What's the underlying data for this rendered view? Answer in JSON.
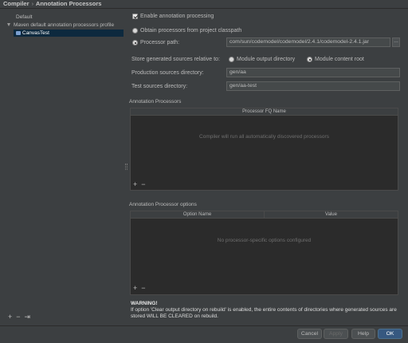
{
  "breadcrumb": {
    "part1": "Compiler",
    "separator": "›",
    "part2": "Annotation Processors"
  },
  "tree": {
    "default_label": "Default",
    "profile_label": "Maven default annotation processors profile",
    "module_label": "CanvasTest"
  },
  "left_toolbar": {
    "add": "+",
    "remove": "−",
    "move": "⇥"
  },
  "enable_processing_label": "Enable annotation processing",
  "obtain_processors_label": "Obtain processors from project classpath",
  "processor_path_label": "Processor path:",
  "processor_path_value": "com/sun/codemodel/codemodel/2.4.1/codemodel-2.4.1.jar",
  "browse_label": "…",
  "store_generated_label": "Store generated sources relative to:",
  "module_output_label": "Module output directory",
  "module_content_label": "Module content root",
  "production_dir_label": "Production sources directory:",
  "production_dir_value": "gen/aa",
  "test_dir_label": "Test sources directory:",
  "test_dir_value": "gen/aa-test",
  "processors_section_label": "Annotation Processors",
  "processors_column_header": "Processor FQ Name",
  "processors_empty_text": "Compiler will run all automatically discovered processors",
  "table_toolbar": {
    "add": "+",
    "remove": "−"
  },
  "options_section_label": "Annotation Processor options",
  "options_column_name": "Option Name",
  "options_column_value": "Value",
  "options_empty_text": "No processor-specific options configured",
  "warning_title": "WARNING!",
  "warning_text": "If option 'Clear output directory on rebuild' is enabled, the entire contents of directories where generated sources are stored WILL BE CLEARED on rebuild.",
  "buttons": {
    "cancel": "Cancel",
    "apply": "Apply",
    "help": "Help",
    "ok": "OK"
  },
  "colors": {
    "background": "#3c3f41",
    "selection": "#0d293e",
    "primary_button": "#365880",
    "table_bg": "#2b2b2b"
  }
}
